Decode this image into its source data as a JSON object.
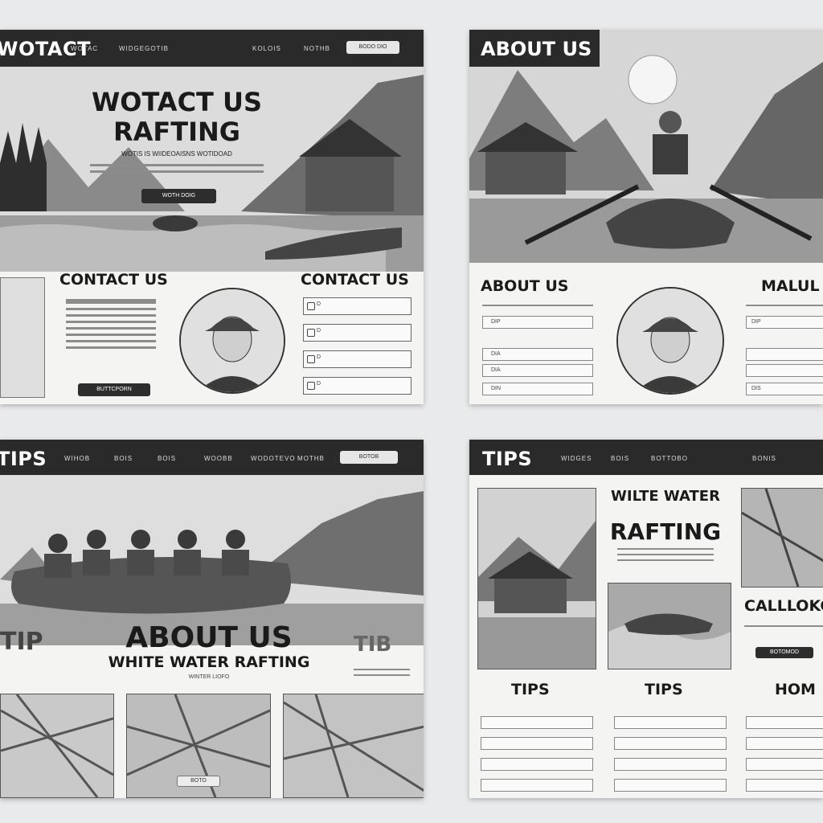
{
  "panel_tl": {
    "brand": "WOTACT",
    "nav": [
      "WOTAC",
      "WIDGEGOTIB",
      "KOLOIS",
      "NOTHB"
    ],
    "nav_button": "BODO DIO",
    "hero_title_1": "WOTACT US",
    "hero_title_2": "RAFTING",
    "hero_sub": "WOTIS IS  WIIDEOAISNS WOTIDOAD",
    "hero_button": "WOTH DOIG",
    "section_left": "CONTACT US",
    "section_right": "CONTACT US",
    "fields": [
      "D",
      "D",
      "D",
      "D"
    ],
    "bottom_button": "BUTTCPORN"
  },
  "panel_tr": {
    "title": "ABOUT US",
    "section_left": "ABOUT US",
    "section_right": "MALUL",
    "rows": [
      "DIP",
      "DIA",
      "DIA",
      "DIN"
    ],
    "right_rows": [
      "DIP",
      "",
      "",
      "DIS"
    ]
  },
  "panel_bl": {
    "brand": "TIPS",
    "nav": [
      "WIHOB",
      "BOIS",
      "BOIS",
      "WOOBB",
      "WODOTEVO",
      "MOTHB"
    ],
    "nav_button": "BOTOB",
    "center_title_1": "ABOUT US",
    "center_title_2": "WHITE WATER RAFTING",
    "center_sub": "WINTER LIOFO",
    "left_badge": "TIP",
    "right_badge": "TIB",
    "tile_button": "BOTO"
  },
  "panel_br": {
    "brand": "TIPS",
    "nav": [
      "WIDGES",
      "BOIS",
      "BOTTOBO",
      "BONIS"
    ],
    "center_title_1": "WILTE WATER",
    "center_title_2": "RAFTING",
    "right_title": "CALLLOKC",
    "right_button": "BOTOMOD",
    "col_titles": [
      "TIPS",
      "TIPS",
      "HOM"
    ]
  },
  "colors": {
    "nav_bg": "#2a2a2a",
    "panel_bg": "#f4f4f3",
    "page_bg": "#e9eaeb",
    "ink": "#1a1a1a"
  }
}
